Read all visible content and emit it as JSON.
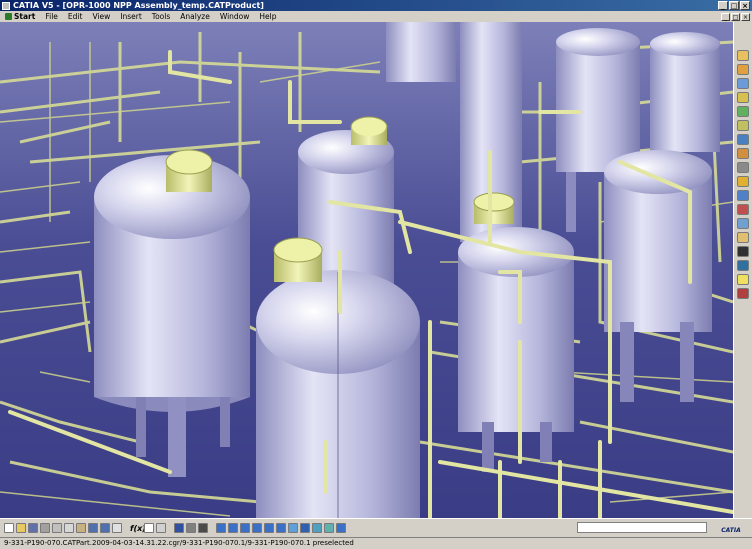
{
  "window": {
    "title": "CATIA V5 - [OPR-1000 NPP Assembly_temp.CATProduct]",
    "controls": [
      "_",
      "□",
      "×"
    ]
  },
  "menubar": {
    "items": [
      "Start",
      "File",
      "Edit",
      "View",
      "Insert",
      "Tools",
      "Analyze",
      "Window",
      "Help"
    ],
    "mdi_controls": [
      "_",
      "□",
      "×"
    ]
  },
  "viewport": {
    "background_top": "#7d80b8",
    "background_bottom": "#3a3d85",
    "tank_color": "#c8c8e8",
    "nozzle_color": "#e6ec9c",
    "pipe_color": "#d8dd98"
  },
  "bottom_toolbar": {
    "formula_label": "f(x)",
    "command_value": ""
  },
  "logo": {
    "text": "CATIA"
  },
  "status": {
    "text": "9-331-P190-070.CATPart.2009-04-03-14.31.22.cgr/9-331-P190-070.1/9-331-P190-070.1 preselected"
  },
  "icons": {
    "right_toolbar": [
      "sketcher-icon",
      "part-design-icon",
      "axis-icon",
      "material-icon",
      "measure-icon",
      "hide-show-icon",
      "catalog-icon",
      "swap-icon",
      "design-table-icon",
      "clash-icon",
      "section-icon",
      "sectioning-icon",
      "distance-icon",
      "simulation-icon",
      "filter-icon",
      "snap-icon",
      "light-icon",
      "cut-icon"
    ],
    "bottom_toolbar": [
      "new-icon",
      "open-icon",
      "save-icon",
      "print-icon",
      "cut-icon",
      "copy-icon",
      "paste-icon",
      "undo-icon",
      "redo-icon",
      "whats-this-icon",
      "fx-icon",
      "knowledge-icon",
      "comment-icon",
      "catalog-browser-icon",
      "quick-select-icon",
      "fly-icon",
      "fit-all-icon",
      "pan-icon",
      "rotate-icon",
      "zoom-in-icon",
      "zoom-out-icon",
      "normal-view-icon",
      "iso-view-icon",
      "render-style-icon",
      "hide-show-icon",
      "swap-visible-icon",
      "layer-icon"
    ]
  }
}
